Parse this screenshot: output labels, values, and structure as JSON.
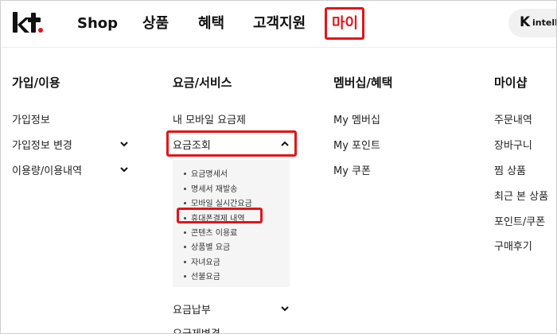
{
  "header": {
    "logo_text": "kt",
    "nav": [
      "Shop",
      "상품",
      "혜택",
      "고객지원",
      "마이"
    ],
    "brand_k": "K",
    "brand_text": "intellig"
  },
  "columns": [
    {
      "title": "가입/이용",
      "items": [
        "가입정보",
        "가입정보 변경",
        "이용량/이용내역"
      ]
    },
    {
      "title": "요금/서비스",
      "items": [
        "내 모바일 요금제",
        "요금조회",
        "요금납부",
        "요금제변경"
      ],
      "sub_items": [
        "요금명세서",
        "명세서 재발송",
        "모바일 실시간요금",
        "휴대폰결제 내역",
        "콘텐츠 이용료",
        "상품별 요금",
        "자녀요금",
        "선불요금"
      ]
    },
    {
      "title": "멤버십/혜택",
      "items": [
        "My 멤버십",
        "My 포인트",
        "My 쿠폰"
      ]
    },
    {
      "title": "마이샵",
      "items": [
        "주문내역",
        "장바구니",
        "찜 상품",
        "최근 본 상품",
        "포인트/쿠폰",
        "구매후기"
      ]
    }
  ],
  "colors": {
    "highlight": "#e2141b",
    "submenu_bg": "#f5f5f5"
  }
}
